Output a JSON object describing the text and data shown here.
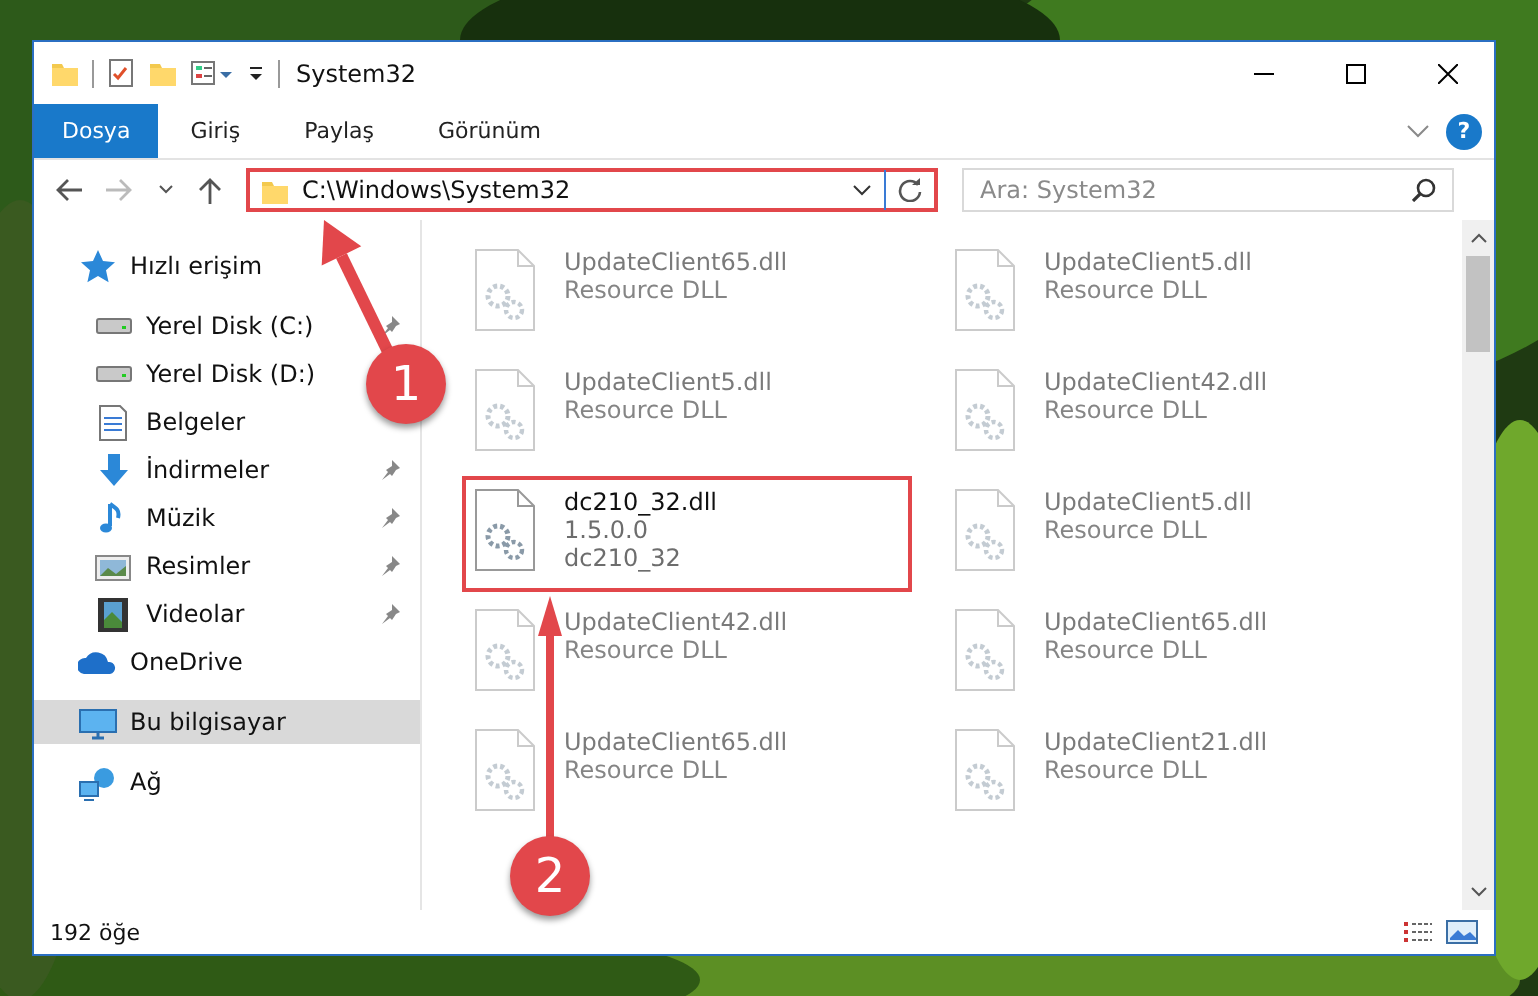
{
  "window": {
    "title": "System32"
  },
  "ribbon": {
    "tabs": [
      {
        "label": "Dosya",
        "selected": true
      },
      {
        "label": "Giriş",
        "selected": false
      },
      {
        "label": "Paylaş",
        "selected": false
      },
      {
        "label": "Görünüm",
        "selected": false
      }
    ],
    "help": "?"
  },
  "address": {
    "path": "C:\\Windows\\System32",
    "highlighted": true
  },
  "search": {
    "placeholder": "Ara: System32"
  },
  "sidebar": {
    "items": [
      {
        "label": "Hızlı erişim",
        "kind": "star",
        "selected": false,
        "children": [
          {
            "label": "Yerel Disk (C:)",
            "kind": "drive",
            "pinned": true,
            "selected": false
          },
          {
            "label": "Yerel Disk (D:)",
            "kind": "drive",
            "pinned": false,
            "selected": false
          },
          {
            "label": "Belgeler",
            "kind": "document",
            "pinned": false,
            "selected": false
          },
          {
            "label": "İndirmeler",
            "kind": "download",
            "pinned": true,
            "selected": false
          },
          {
            "label": "Müzik",
            "kind": "music",
            "pinned": true,
            "selected": false
          },
          {
            "label": "Resimler",
            "kind": "pictures",
            "pinned": true,
            "selected": false
          },
          {
            "label": "Videolar",
            "kind": "video",
            "pinned": true,
            "selected": false
          }
        ]
      },
      {
        "label": "OneDrive",
        "kind": "cloud",
        "selected": false
      },
      {
        "label": "Bu bilgisayar",
        "kind": "computer",
        "selected": true
      },
      {
        "label": "Ağ",
        "kind": "network",
        "selected": false
      }
    ]
  },
  "files": [
    {
      "name": "UpdateClient65.dll",
      "details": [
        "Resource DLL"
      ],
      "blurred": true,
      "highlighted": false
    },
    {
      "name": "UpdateClient5.dll",
      "details": [
        "Resource DLL"
      ],
      "blurred": true,
      "highlighted": false
    },
    {
      "name": "UpdateClient5.dll",
      "details": [
        "Resource DLL"
      ],
      "blurred": true,
      "highlighted": false
    },
    {
      "name": "UpdateClient42.dll",
      "details": [
        "Resource DLL"
      ],
      "blurred": true,
      "highlighted": false
    },
    {
      "name": "dc210_32.dll",
      "details": [
        "1.5.0.0",
        "dc210_32"
      ],
      "blurred": false,
      "highlighted": true
    },
    {
      "name": "UpdateClient5.dll",
      "details": [
        "Resource DLL"
      ],
      "blurred": true,
      "highlighted": false
    },
    {
      "name": "UpdateClient42.dll",
      "details": [
        "Resource DLL"
      ],
      "blurred": true,
      "highlighted": false
    },
    {
      "name": "UpdateClient65.dll",
      "details": [
        "Resource DLL"
      ],
      "blurred": true,
      "highlighted": false
    },
    {
      "name": "UpdateClient65.dll",
      "details": [
        "Resource DLL"
      ],
      "blurred": true,
      "highlighted": false
    },
    {
      "name": "UpdateClient21.dll",
      "details": [
        "Resource DLL"
      ],
      "blurred": true,
      "highlighted": false
    }
  ],
  "status_bar": {
    "count": "192 öğe"
  },
  "annotations": [
    {
      "number": "1"
    },
    {
      "number": "2"
    }
  ]
}
